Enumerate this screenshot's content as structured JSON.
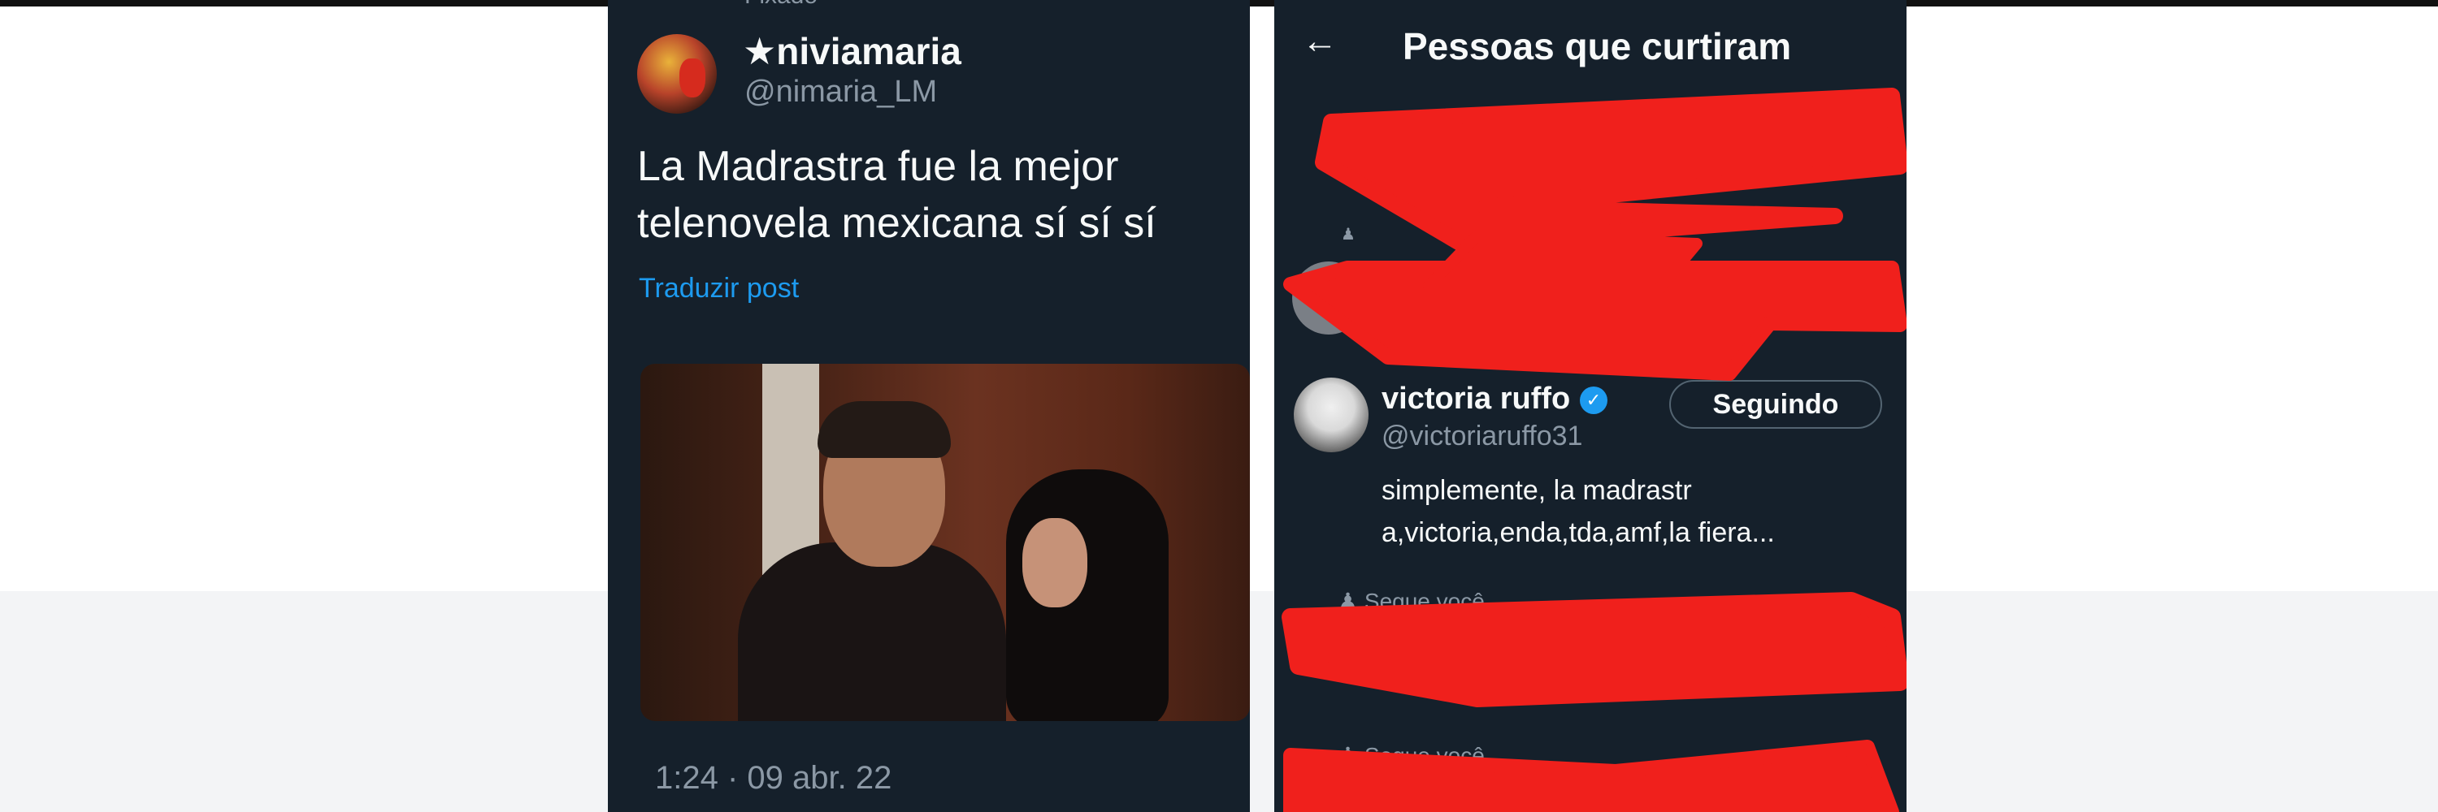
{
  "left_post": {
    "pinned_label": "Fixado",
    "display_name": "★niviamaria",
    "handle": "@nimaria_LM",
    "text_line1": "La Madrastra fue la mejor",
    "text_line2": "telenovela mexicana sí sí sí",
    "translate_label": "Traduzir post",
    "timestamp": "1:24 · 09 abr. 22"
  },
  "likes_screen": {
    "back_icon": "←",
    "title": "Pessoas que curtiram",
    "liked_user": {
      "name": "victoria ruffo",
      "verified_icon": "✓",
      "handle": "@victoriaruffo31",
      "follow_button": "Seguindo",
      "bio_line1": "simplemente, la madrastr",
      "bio_line2": "a,victoria,enda,tda,amf,la fiera..."
    },
    "follows_you_1": "Segue você",
    "follows_you_2": "Segue você"
  },
  "colors": {
    "panel_bg": "#15202b",
    "link_blue": "#1d9bf0",
    "redaction_red": "#f0201c"
  }
}
